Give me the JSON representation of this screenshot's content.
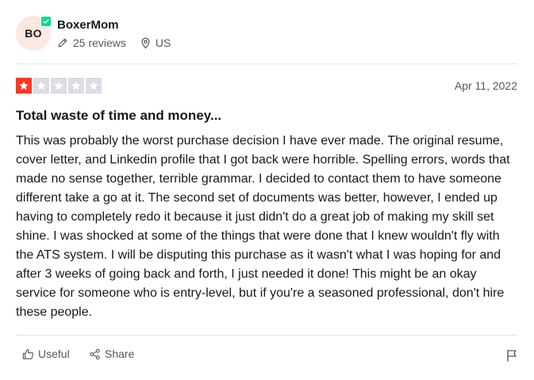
{
  "reviewer": {
    "initials": "BO",
    "name": "BoxerMom",
    "reviews": "25 reviews",
    "country": "US",
    "avatar_bg": "#fbe8e0",
    "verified_color": "#04da8d"
  },
  "rating": {
    "stars": 1,
    "max": 5,
    "filled_color": "#ff3722",
    "empty_color": "#dcdce6"
  },
  "review": {
    "date": "Apr 11, 2022",
    "title": "Total waste of time and money...",
    "body": "This was probably the worst purchase decision I have ever made. The original resume, cover letter, and Linkedin profile that I got back were horrible. Spelling errors, words that made no sense together, terrible grammar. I decided to contact them to have someone different take a go at it. The second set of documents was better, however, I ended up having to completely redo it because it just didn't do a great job of making my skill set shine. I was shocked at some of the things that were done that I knew wouldn't fly with the ATS system. I will be disputing this purchase as it wasn't what I was hoping for and after 3 weeks of going back and forth, I just needed it done! This might be an okay service for someone who is entry-level, but if you're a seasoned professional, don't hire these people."
  },
  "actions": {
    "useful_label": "Useful",
    "share_label": "Share",
    "icons": [
      "thumbs-up-icon",
      "share-icon",
      "flag-icon"
    ]
  }
}
